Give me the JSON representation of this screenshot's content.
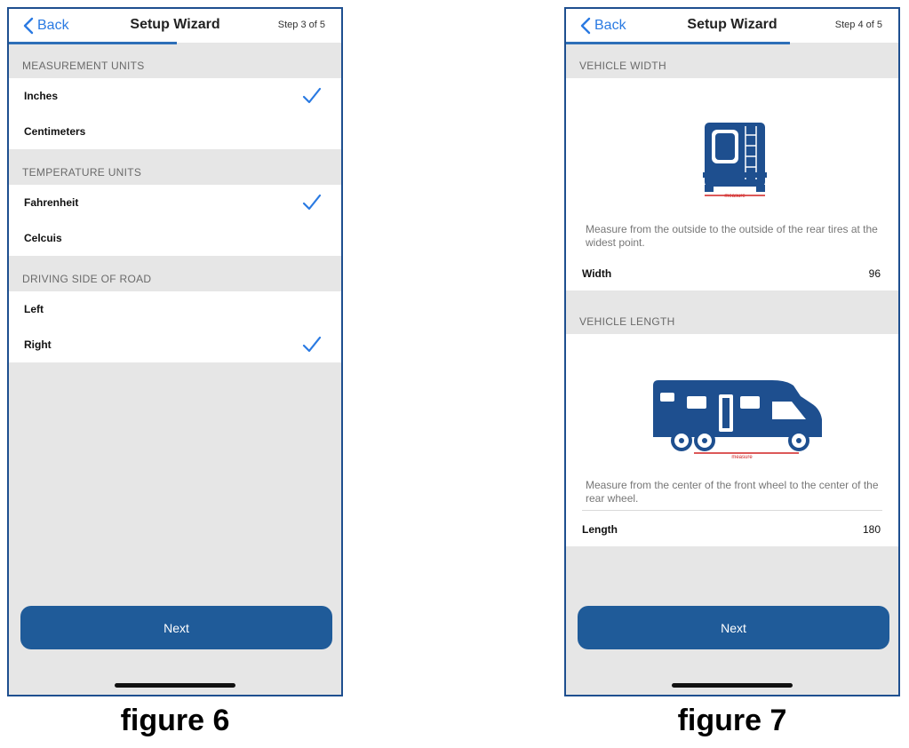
{
  "figure6": {
    "nav": {
      "back": "Back",
      "title": "Setup Wizard",
      "step": "Step 3 of 5"
    },
    "sections": [
      {
        "header": "MEASUREMENT UNITS",
        "options": [
          {
            "label": "Inches",
            "checked": true
          },
          {
            "label": "Centimeters",
            "checked": false
          }
        ]
      },
      {
        "header": "TEMPERATURE UNITS",
        "options": [
          {
            "label": "Fahrenheit",
            "checked": true
          },
          {
            "label": "Celcuis",
            "checked": false
          }
        ]
      },
      {
        "header": "DRIVING SIDE OF ROAD",
        "options": [
          {
            "label": "Left",
            "checked": false
          },
          {
            "label": "Right",
            "checked": true
          }
        ]
      }
    ],
    "next": "Next",
    "caption": "figure 6"
  },
  "figure7": {
    "nav": {
      "back": "Back",
      "title": "Setup Wizard",
      "step": "Step 4 of 5"
    },
    "width": {
      "header": "VEHICLE WIDTH",
      "measure_tag": "measure",
      "description": "Measure from the outside to the outside of the rear tires at the widest point.",
      "label": "Width",
      "value": "96"
    },
    "length": {
      "header": "VEHICLE LENGTH",
      "measure_tag": "measure",
      "description": "Measure from the center of the front wheel to the center of the rear wheel.",
      "label": "Length",
      "value": "180"
    },
    "next": "Next",
    "caption": "figure 7"
  },
  "colors": {
    "accent": "#2a7ae2",
    "button": "#1f5b99",
    "vehicle": "#1e4f8f",
    "measure_line": "#d02020"
  },
  "icons": {
    "back": "chevron-left-icon",
    "check": "checkmark-icon",
    "rv_rear": "rv-rear-icon",
    "rv_side": "rv-side-icon"
  }
}
